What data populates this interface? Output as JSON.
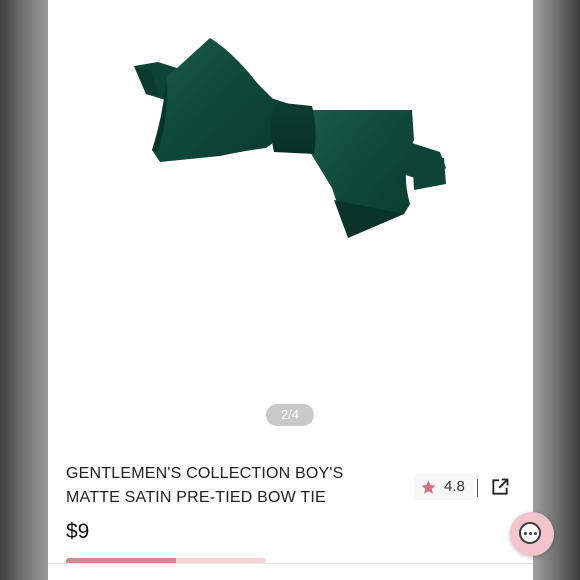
{
  "gallery": {
    "indicator": "2/4",
    "current_slide": 2,
    "total_slides": 4,
    "product_color": "#0f4a3c"
  },
  "product": {
    "title_line1": "GENTLEMEN'S COLLECTION BOY'S",
    "title_line2": "MATTE SATIN PRE-TIED BOW TIE",
    "price": "$9"
  },
  "rating": {
    "value": "4.8",
    "icon": "star-icon",
    "star_color": "#d9707f"
  },
  "actions": {
    "share_icon": "external-share-icon",
    "chat_icon": "chat-bubble-icon"
  },
  "sale_progress": 0.55
}
